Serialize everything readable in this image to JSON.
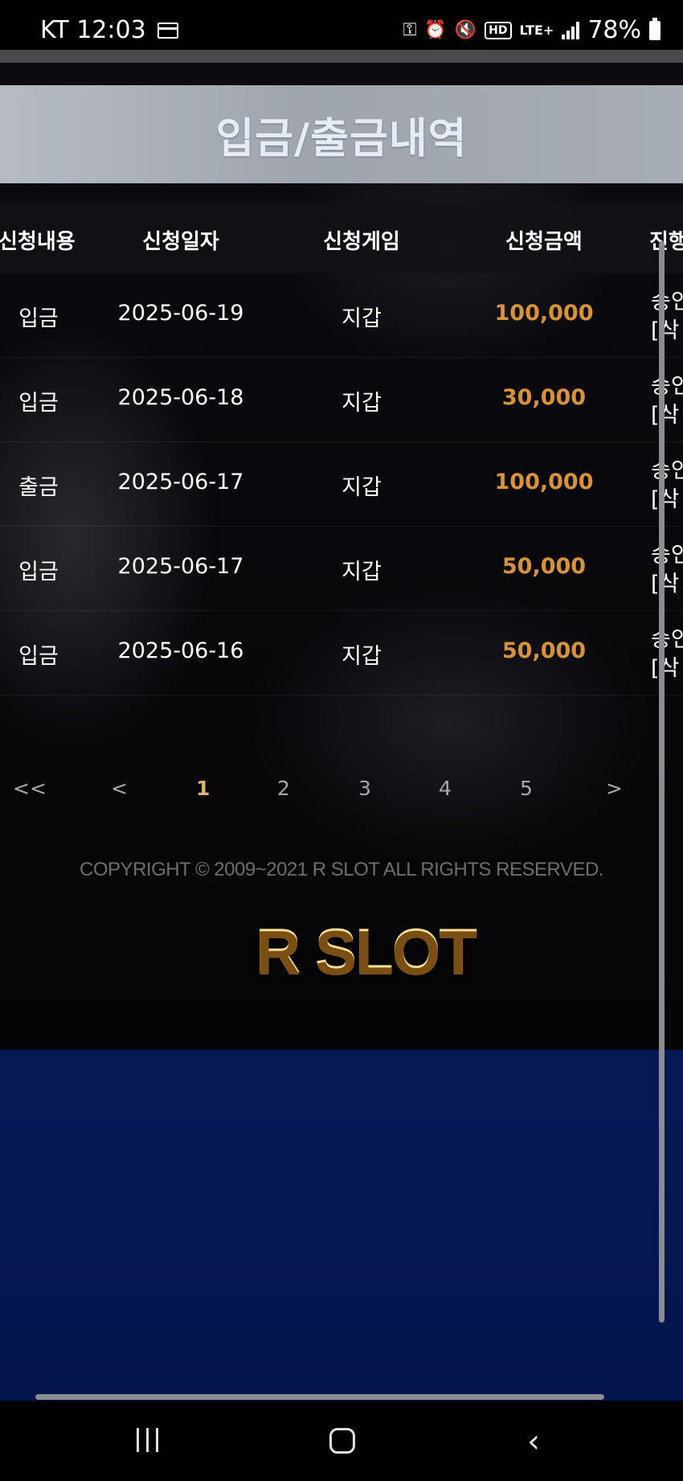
{
  "status_bar": {
    "carrier_time": "KT 12:03",
    "network": "LTE+",
    "battery": "78%"
  },
  "page": {
    "title": "입금/출금내역"
  },
  "table": {
    "headers": [
      "신청내용",
      "신청일자",
      "신청게임",
      "신청금액",
      "진행"
    ],
    "rows": [
      {
        "type": "입금",
        "date": "2025-06-19",
        "game": "지갑",
        "amount": "100,000",
        "status": "승인",
        "status_sub": "[삭"
      },
      {
        "type": "입금",
        "date": "2025-06-18",
        "game": "지갑",
        "amount": "30,000",
        "status": "승인",
        "status_sub": "[삭"
      },
      {
        "type": "출금",
        "date": "2025-06-17",
        "game": "지갑",
        "amount": "100,000",
        "status": "승인",
        "status_sub": "[삭"
      },
      {
        "type": "입금",
        "date": "2025-06-17",
        "game": "지갑",
        "amount": "50,000",
        "status": "승인",
        "status_sub": "[삭"
      },
      {
        "type": "입금",
        "date": "2025-06-16",
        "game": "지갑",
        "amount": "50,000",
        "status": "승인",
        "status_sub": "[삭"
      }
    ]
  },
  "pagination": {
    "first": "<<",
    "prev": "<",
    "pages": [
      "1",
      "2",
      "3",
      "4",
      "5"
    ],
    "active_page": "1",
    "next": ">"
  },
  "footer": {
    "copyright": "COPYRIGHT © 2009~2021 R SLOT ALL RIGHTS RESERVED.",
    "logo": "R SLOT"
  },
  "colors": {
    "amount": "#d8933a",
    "active_page": "#d7b57a",
    "header_bar": "#a7acb4",
    "blue_area": "#061957"
  }
}
